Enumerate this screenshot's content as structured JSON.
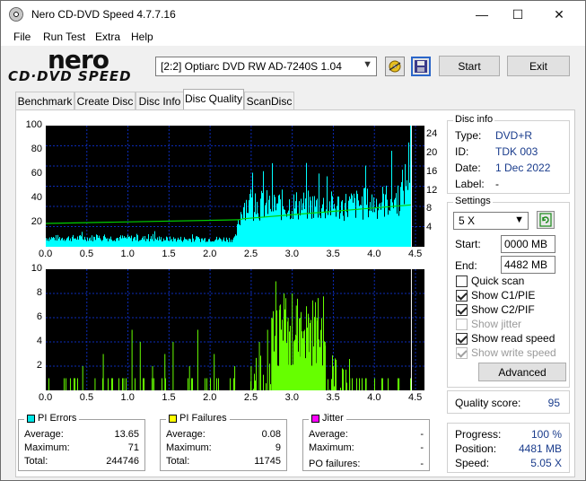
{
  "window": {
    "title": "Nero CD-DVD Speed 4.7.7.16",
    "controls": [
      "—",
      "☐",
      "✕"
    ]
  },
  "menu": [
    "File",
    "Run Test",
    "Extra",
    "Help"
  ],
  "logo": {
    "line1": "nero",
    "line2": "CD·DVD SPEED"
  },
  "toolbar": {
    "drive": "[2:2]   Optiarc DVD RW AD-7240S 1.04",
    "start_label": "Start",
    "exit_label": "Exit",
    "icons": [
      "eject-icon",
      "save-icon"
    ]
  },
  "tabs": [
    "Benchmark",
    "Create Disc",
    "Disc Info",
    "Disc Quality",
    "ScanDisc"
  ],
  "active_tab": "Disc Quality",
  "chart_data": [
    {
      "type": "area",
      "name": "PI Errors",
      "x_ticks": [
        "0.0",
        "0.5",
        "1.0",
        "1.5",
        "2.0",
        "2.5",
        "3.0",
        "3.5",
        "4.0",
        "4.5"
      ],
      "y_ticks_left": [
        "100",
        "80",
        "60",
        "40",
        "20"
      ],
      "y_ticks_right": [
        "24",
        "20",
        "16",
        "12",
        "8",
        "4"
      ],
      "xlim": [
        0,
        4.5
      ],
      "ylim": [
        0,
        100
      ],
      "y2lim": [
        0,
        26
      ],
      "x": [
        0.0,
        0.5,
        1.0,
        1.5,
        2.0,
        2.3,
        2.4,
        2.5,
        3.0,
        3.5,
        4.0,
        4.3,
        4.4,
        4.45
      ],
      "values": [
        8,
        8,
        8,
        7,
        7,
        7,
        40,
        38,
        38,
        37,
        40,
        45,
        65,
        100
      ],
      "read_speed_x": [
        0.0,
        2.35,
        2.4,
        4.45
      ],
      "read_speed_values": [
        5.0,
        5.8,
        6.0,
        9.0
      ],
      "colors": {
        "errors": "#00ffff",
        "speed": "#00d000",
        "grid": "#0b2bb8"
      }
    },
    {
      "type": "bar",
      "name": "PI Failures",
      "x_ticks": [
        "0.0",
        "0.5",
        "1.0",
        "1.5",
        "2.0",
        "2.5",
        "3.0",
        "3.5",
        "4.0",
        "4.5"
      ],
      "y_ticks_left": [
        "10",
        "8",
        "6",
        "4",
        "2"
      ],
      "xlim": [
        0,
        4.5
      ],
      "ylim": [
        0,
        10
      ],
      "x": [
        0.3,
        0.45,
        0.6,
        0.7,
        0.95,
        1.05,
        1.15,
        1.3,
        1.45,
        1.55,
        1.75,
        1.85,
        2.05,
        2.3,
        2.5,
        2.6,
        2.7,
        2.75,
        2.8,
        2.85,
        2.9,
        2.95,
        3.0,
        3.05,
        3.1,
        3.15,
        3.2,
        3.25,
        3.3,
        3.35,
        3.4,
        3.5,
        3.7,
        3.9,
        4.1,
        4.3,
        4.45
      ],
      "values": [
        1,
        2,
        1,
        3,
        1,
        5,
        4,
        2,
        3,
        4,
        2,
        5,
        3,
        2,
        2,
        4,
        5,
        6,
        9,
        7,
        8,
        6,
        8,
        7,
        6,
        5,
        6,
        7,
        6,
        5,
        4,
        2,
        1,
        1,
        1,
        1,
        10
      ],
      "colors": {
        "failures": "#66ff00",
        "grid": "#0b2bb8"
      }
    }
  ],
  "stats": {
    "pi_errors": {
      "title": "PI Errors",
      "color": "#00e5e5",
      "average_label": "Average:",
      "average": "13.65",
      "maximum_label": "Maximum:",
      "maximum": "71",
      "total_label": "Total:",
      "total": "244746"
    },
    "pi_failures": {
      "title": "PI Failures",
      "color": "#ffff00",
      "average_label": "Average:",
      "average": "0.08",
      "maximum_label": "Maximum:",
      "maximum": "9",
      "total_label": "Total:",
      "total": "11745"
    },
    "jitter": {
      "title": "Jitter",
      "color": "#ff00ff",
      "average_label": "Average:",
      "average": "-",
      "maximum_label": "Maximum:",
      "maximum": "-",
      "po_label": "PO failures:",
      "po": "-"
    }
  },
  "disc_info": {
    "title": "Disc info",
    "type_label": "Type:",
    "type": "DVD+R",
    "id_label": "ID:",
    "id": "TDK 003",
    "date_label": "Date:",
    "date": "1 Dec 2022",
    "label_label": "Label:",
    "label": "-"
  },
  "settings": {
    "title": "Settings",
    "speed": "5 X",
    "start_label": "Start:",
    "start": "0000 MB",
    "end_label": "End:",
    "end": "4482 MB",
    "checks": [
      {
        "label": "Quick scan",
        "checked": false,
        "enabled": true
      },
      {
        "label": "Show C1/PIE",
        "checked": true,
        "enabled": true
      },
      {
        "label": "Show C2/PIF",
        "checked": true,
        "enabled": true
      },
      {
        "label": "Show jitter",
        "checked": false,
        "enabled": false
      },
      {
        "label": "Show read speed",
        "checked": true,
        "enabled": true
      },
      {
        "label": "Show write speed",
        "checked": true,
        "enabled": false
      }
    ],
    "advanced_label": "Advanced"
  },
  "quality": {
    "label": "Quality score:",
    "value": "95"
  },
  "progress": {
    "progress_label": "Progress:",
    "progress": "100 %",
    "position_label": "Position:",
    "position": "4481 MB",
    "speed_label": "Speed:",
    "speed": "5.05 X"
  }
}
